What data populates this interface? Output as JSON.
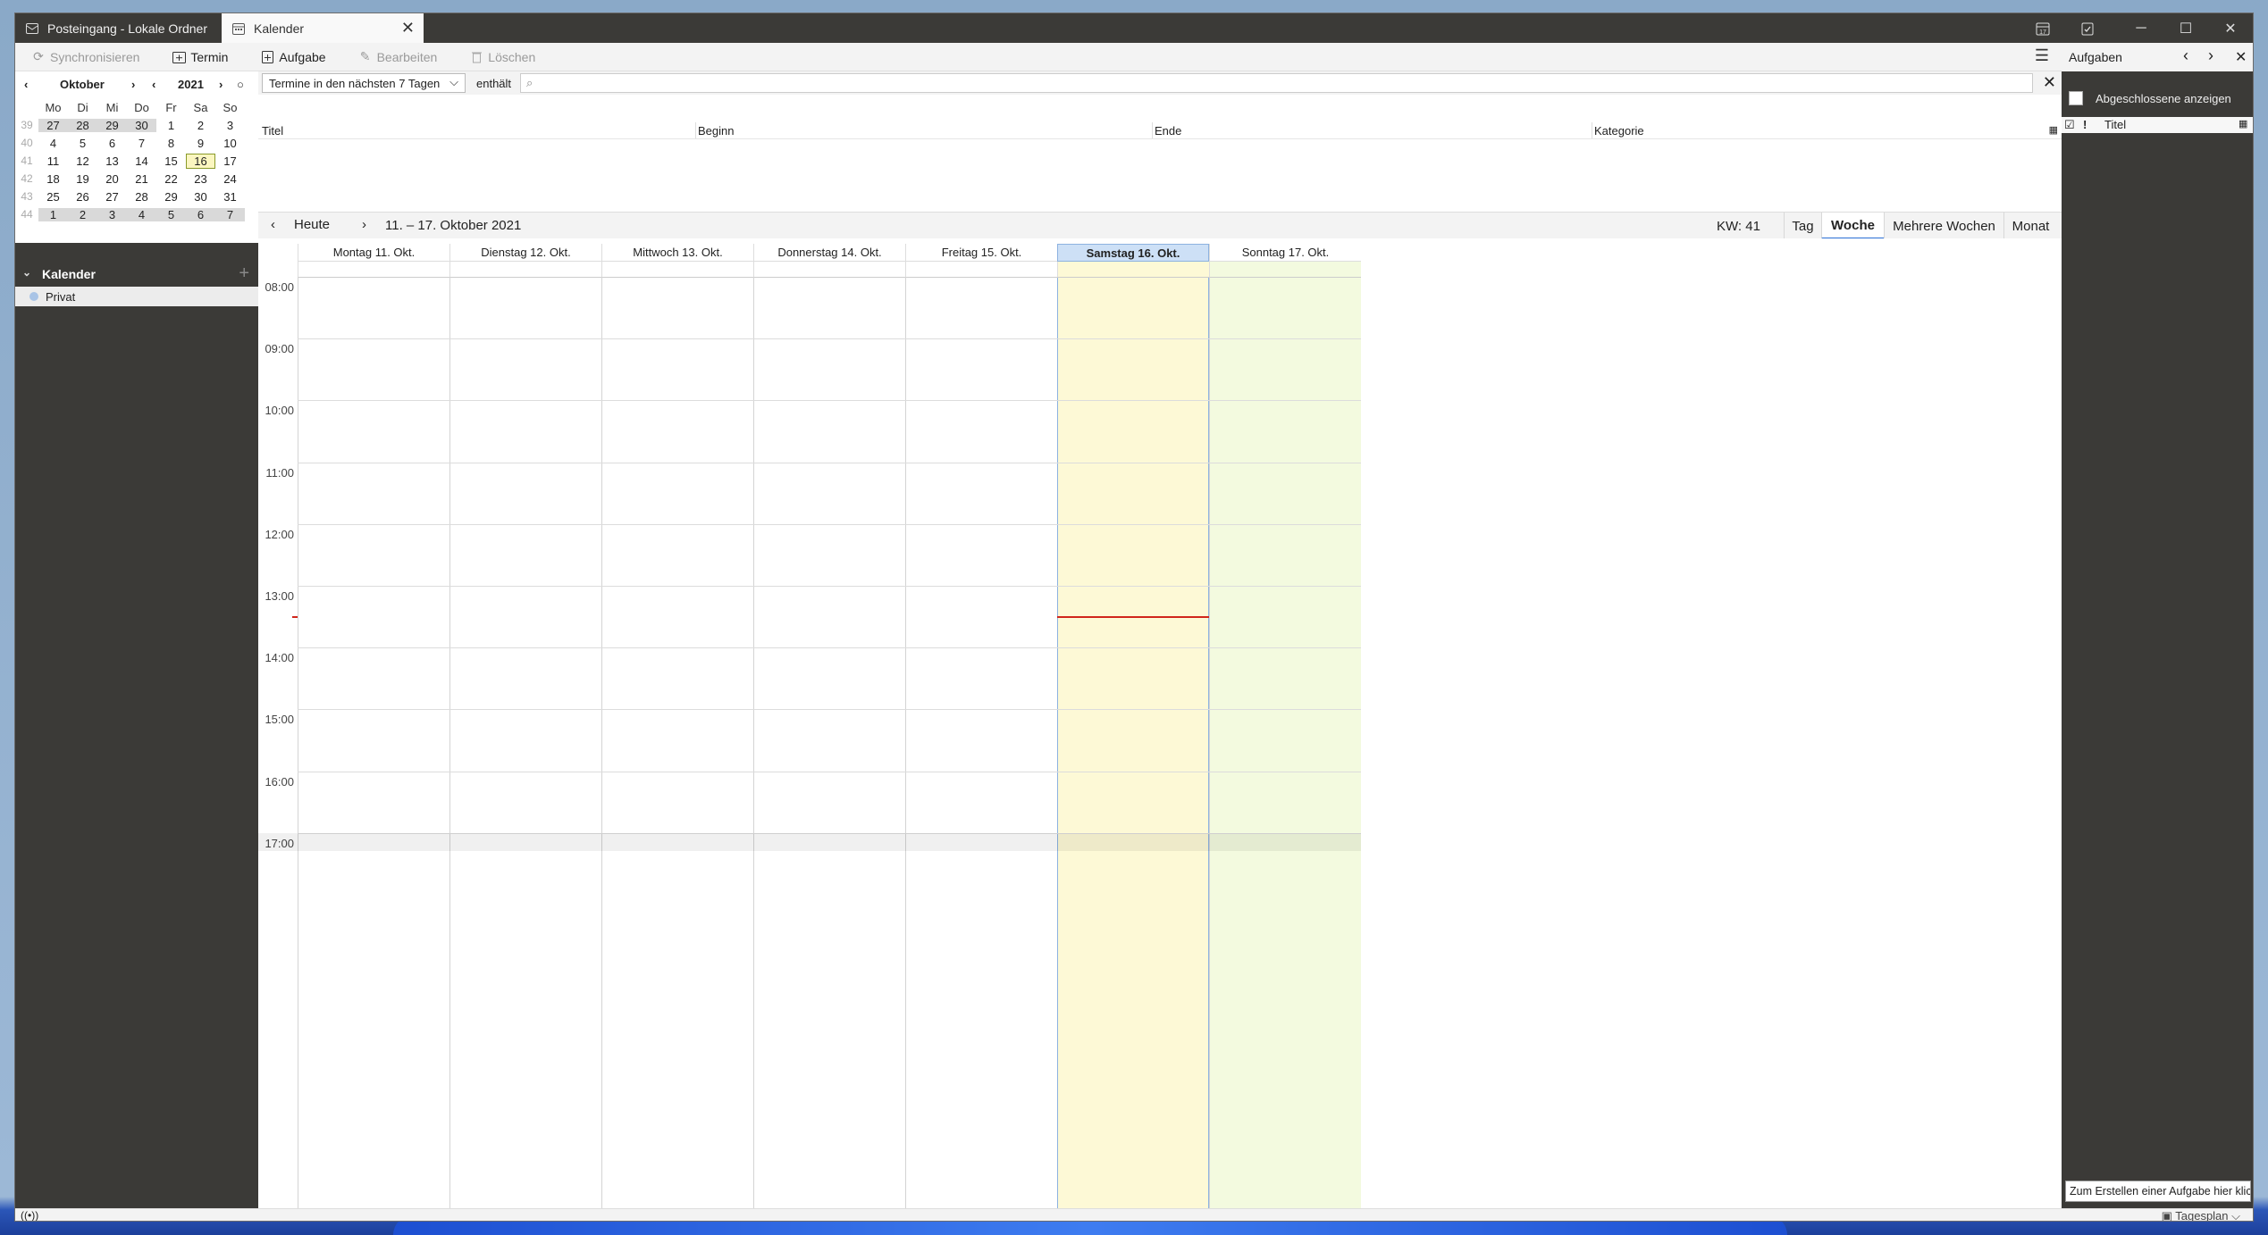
{
  "tabs": [
    {
      "label": "Posteingang - Lokale Ordner",
      "icon": "mail-icon"
    },
    {
      "label": "Kalender",
      "icon": "calendar-icon"
    }
  ],
  "toolbar": {
    "sync": "Synchronisieren",
    "event": "Termin",
    "task": "Aufgabe",
    "edit": "Bearbeiten",
    "delete": "Löschen"
  },
  "minimonth": {
    "month": "Oktober",
    "year": "2021",
    "weekdays": [
      "Mo",
      "Di",
      "Mi",
      "Do",
      "Fr",
      "Sa",
      "So"
    ],
    "weeks": [
      {
        "kw": "39",
        "days": [
          "27",
          "28",
          "29",
          "30",
          "1",
          "2",
          "3"
        ]
      },
      {
        "kw": "40",
        "days": [
          "4",
          "5",
          "6",
          "7",
          "8",
          "9",
          "10"
        ]
      },
      {
        "kw": "41",
        "days": [
          "11",
          "12",
          "13",
          "14",
          "15",
          "16",
          "17"
        ]
      },
      {
        "kw": "42",
        "days": [
          "18",
          "19",
          "20",
          "21",
          "22",
          "23",
          "24"
        ]
      },
      {
        "kw": "43",
        "days": [
          "25",
          "26",
          "27",
          "28",
          "29",
          "30",
          "31"
        ]
      },
      {
        "kw": "44",
        "days": [
          "1",
          "2",
          "3",
          "4",
          "5",
          "6",
          "7"
        ]
      }
    ]
  },
  "calendars": {
    "header": "Kalender",
    "items": [
      {
        "name": "Privat",
        "color": "#a9c4e6"
      }
    ]
  },
  "filter": {
    "range": "Termine in den nächsten 7 Tagen",
    "contains": "enthält"
  },
  "list_columns": [
    "Titel",
    "Beginn",
    "Ende",
    "Kategorie"
  ],
  "nav": {
    "today": "Heute",
    "range": "11. – 17. Oktober 2021",
    "kw": "KW: 41",
    "views": [
      "Tag",
      "Woche",
      "Mehrere Wochen",
      "Monat"
    ],
    "active_view": "Woche"
  },
  "days": [
    "Montag 11. Okt.",
    "Dienstag 12. Okt.",
    "Mittwoch 13. Okt.",
    "Donnerstag 14. Okt.",
    "Freitag 15. Okt.",
    "Samstag 16. Okt.",
    "Sonntag 17. Okt."
  ],
  "hours": [
    "08:00",
    "09:00",
    "10:00",
    "11:00",
    "12:00",
    "13:00",
    "14:00",
    "15:00",
    "16:00",
    "17:00"
  ],
  "tasks": {
    "header": "Aufgaben",
    "show_completed": "Abgeschlossene anzeigen",
    "title_col": "Titel",
    "create_placeholder": "Zum Erstellen einer Aufgabe hier klic"
  },
  "status": {
    "day_plan": "Tagesplan"
  },
  "colors": {
    "today_column": "#fdf9d6",
    "weekend_column": "#f3fadf",
    "now_line": "#d0261c",
    "chrome_dark": "#3b3a37"
  }
}
